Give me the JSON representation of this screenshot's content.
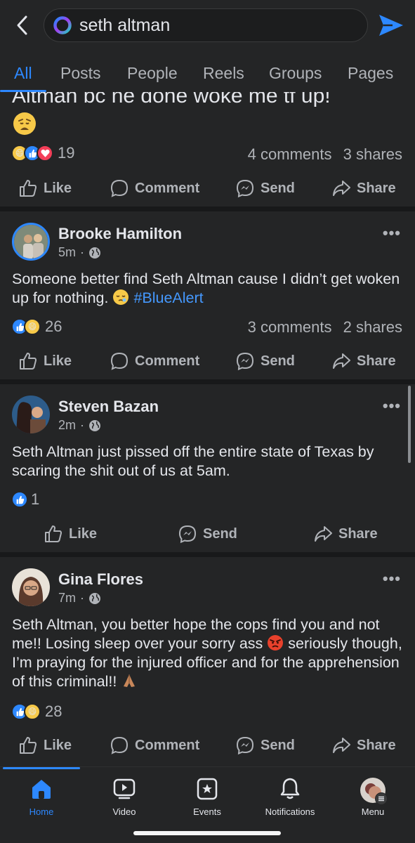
{
  "search": {
    "query": "seth altman"
  },
  "tabs": [
    "All",
    "Posts",
    "People",
    "Reels",
    "Groups",
    "Pages"
  ],
  "posts": [
    {
      "text_partial": "Altman bc he done woke me tf up!",
      "reaction_count": "19",
      "comments": "4 comments",
      "shares": "3 shares",
      "reactions": [
        "haha",
        "like",
        "love"
      ]
    },
    {
      "author": "Brooke Hamilton",
      "time": "5m",
      "text": "Someone better find Seth Altman cause I didn’t get woken up for nothing.",
      "hashtag": "#BlueAlert",
      "reaction_count": "26",
      "comments": "3 comments",
      "shares": "2 shares",
      "reactions": [
        "like",
        "haha"
      ]
    },
    {
      "author": "Steven Bazan",
      "time": "2m",
      "text": "Seth Altman just pissed off the entire state of Texas by scaring the shit out of us at 5am.",
      "reaction_count": "1",
      "reactions": [
        "like"
      ]
    },
    {
      "author": "Gina Flores",
      "time": "7m",
      "text_1": "Seth Altman, you better hope the cops find you and not me!! Losing sleep over your sorry ass",
      "text_2": "seriously though, I’m praying for the injured officer and for the apprehension of this criminal!!",
      "reaction_count": "28",
      "reactions": [
        "like",
        "haha"
      ]
    }
  ],
  "actions": {
    "like": "Like",
    "comment": "Comment",
    "send": "Send",
    "share": "Share"
  },
  "meta_sep": "·",
  "more": "•••",
  "bottom_nav": [
    "Home",
    "Video",
    "Events",
    "Notifications",
    "Menu"
  ],
  "colors": {
    "accent": "#2d88ff",
    "background": "#242526",
    "divider": "#18191a",
    "text": "#e4e6eb",
    "muted": "#b0b3b8"
  }
}
